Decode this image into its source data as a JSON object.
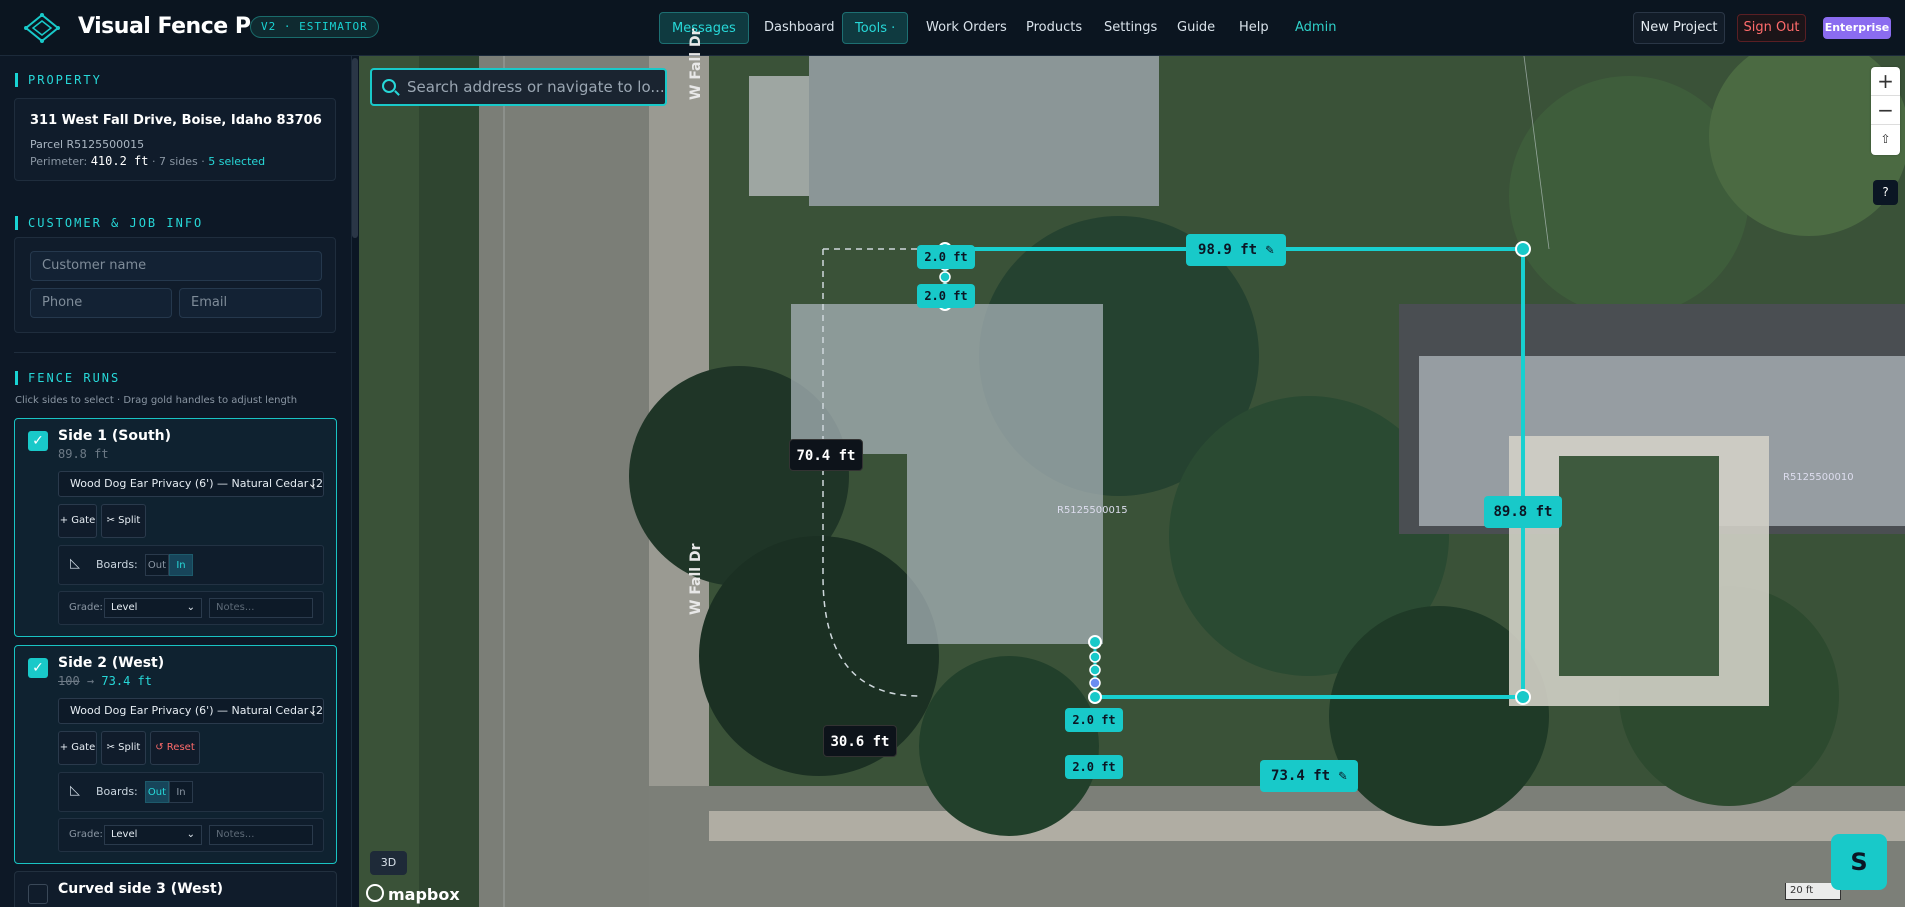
{
  "app": {
    "brand": "Visual Fence Pro",
    "version_badge": "V2 · ESTIMATOR",
    "accent": "#19c9c9"
  },
  "nav": {
    "items": [
      {
        "label": "Messages",
        "active": true
      },
      {
        "label": "Dashboard"
      },
      {
        "label": "Tools ·"
      },
      {
        "label": "Work Orders"
      },
      {
        "label": "Products"
      },
      {
        "label": "Settings"
      },
      {
        "label": "Guide"
      },
      {
        "label": "Help"
      },
      {
        "label": "Admin"
      }
    ],
    "new_project": "New Project",
    "sign_out": "Sign Out",
    "plan_badge": "Enterprise"
  },
  "property": {
    "section_title": "PROPERTY",
    "address": "311 West Fall Drive, Boise, Idaho 83706",
    "parcel": "Parcel R5125500015",
    "perimeter_label": "Perimeter:",
    "perimeter_value": "410.2 ft",
    "sides_text": "· 7 sides ·",
    "selected_text": "5 selected"
  },
  "customer": {
    "section_title": "CUSTOMER & JOB INFO",
    "name_placeholder": "Customer name",
    "phone_placeholder": "Phone",
    "email_placeholder": "Email"
  },
  "fence_runs": {
    "section_title": "FENCE RUNS",
    "hint": "Click sides to select · Drag gold handles to adjust length",
    "runs": [
      {
        "title": "Side 1 (South)",
        "length": "89.8 ft",
        "product": "Wood Dog Ear Privacy (6') — Natural Cedar [2",
        "gate_label": "+ Gate",
        "split_label": "✂ Split",
        "boards_label": "Boards:",
        "out_label": "Out",
        "in_label": "In",
        "boards_selected": "In",
        "grade_label": "Grade:",
        "grade_value": "Level",
        "notes_placeholder": "Notes..."
      },
      {
        "title": "Side 2 (West)",
        "length_old": "100",
        "arrow": "→",
        "length": "73.4 ft",
        "product": "Wood Dog Ear Privacy (6') — Natural Cedar [2",
        "gate_label": "+ Gate",
        "split_label": "✂ Split",
        "reset_label": "↺ Reset",
        "boards_label": "Boards:",
        "out_label": "Out",
        "in_label": "In",
        "boards_selected": "Out",
        "grade_label": "Grade:",
        "grade_value": "Level",
        "notes_placeholder": "Notes..."
      },
      {
        "title": "Curved side 3 (West)",
        "checked": false
      }
    ]
  },
  "map": {
    "search_placeholder": "Search address or navigate to lo...",
    "road_label": "W Fall Dr",
    "parcel_label_main": "R5125500015",
    "parcel_label_right": "R5125500010",
    "dimensions": {
      "top": "98.9 ft",
      "right": "89.8 ft",
      "bottom": "73.4 ft",
      "left_gray": "70.4 ft",
      "curve_gray": "30.6 ft",
      "small_1": "2.0 ft",
      "small_2": "2.0 ft",
      "small_3": "2.0 ft",
      "small_4": "2.0 ft"
    },
    "btn_3d": "3D",
    "attribution": "mapbox",
    "scale": "20 ft",
    "fab_label": "S",
    "zoom_in": "+",
    "zoom_out": "−",
    "compass": "⇧",
    "help": "?"
  }
}
